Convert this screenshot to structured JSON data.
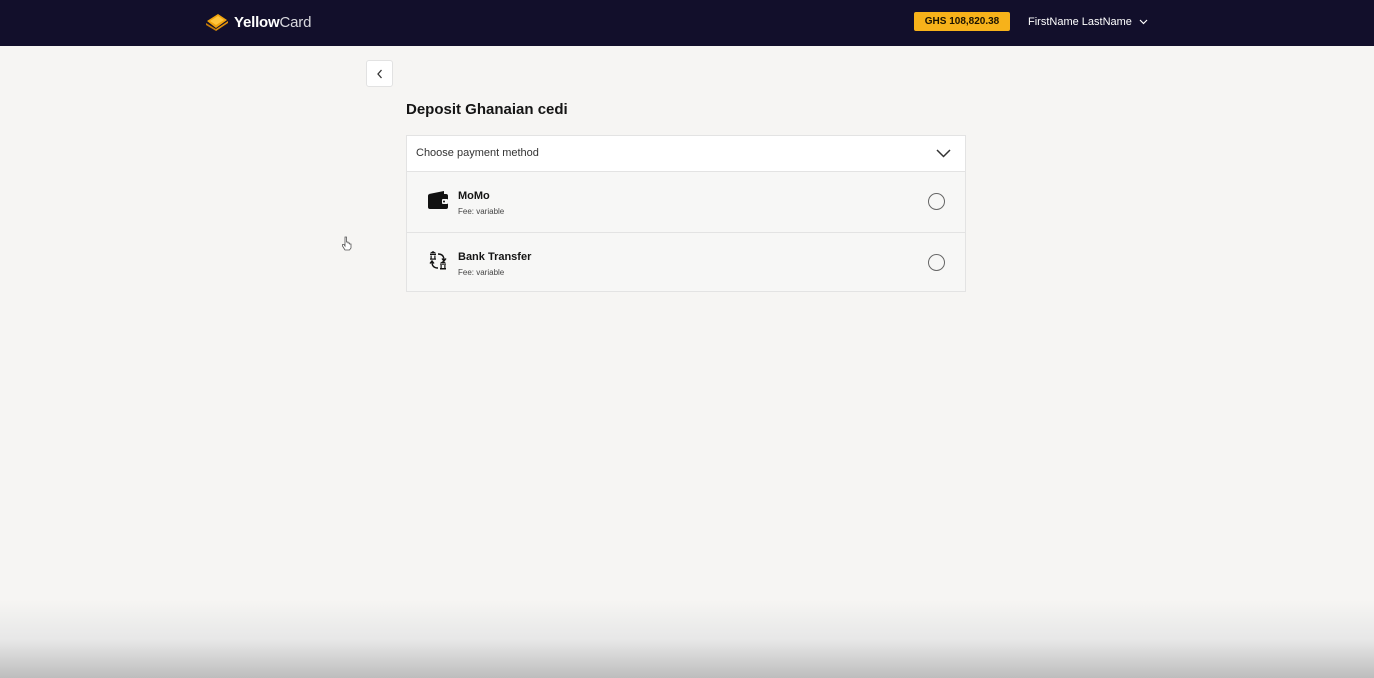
{
  "header": {
    "logo": {
      "bold": "Yellow",
      "light": "Card"
    },
    "balance": "GHS 108,820.38",
    "user_name": "FirstName LastName"
  },
  "page": {
    "title": "Deposit Ghanaian cedi"
  },
  "payment_select": {
    "placeholder": "Choose payment method",
    "options": [
      {
        "title": "MoMo",
        "fee": "Fee: variable",
        "icon": "wallet-icon",
        "selected": false
      },
      {
        "title": "Bank Transfer",
        "fee": "Fee: variable",
        "icon": "bank-transfer-icon",
        "selected": false
      }
    ]
  },
  "colors": {
    "topbar_bg": "#120f2b",
    "accent": "#f7b21a",
    "page_bg": "#f6f5f3"
  }
}
